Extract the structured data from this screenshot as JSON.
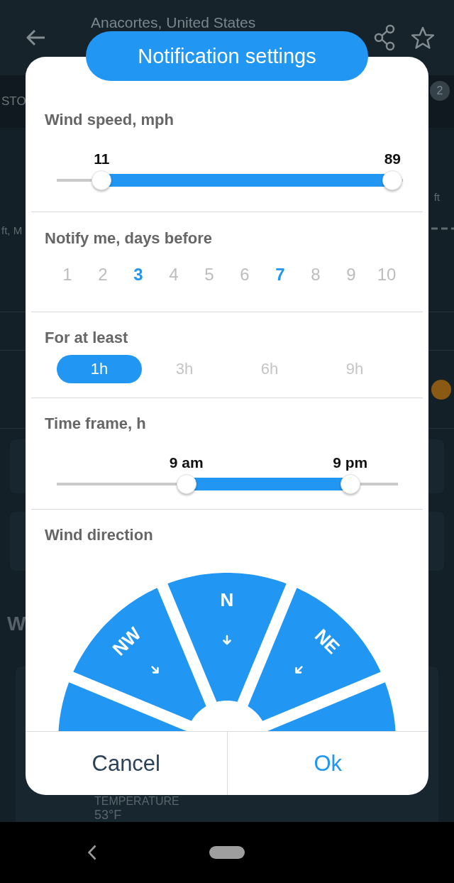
{
  "app_bar": {
    "title": "Anacortes, United States"
  },
  "tab_strip": {
    "tab_label": "STO",
    "badge": "2"
  },
  "content": {
    "right_unit": "ft",
    "left_unit": "ft, M",
    "section_letter": "W",
    "card": {
      "label": "TEMPERATURE",
      "value": "53°F"
    }
  },
  "dialog": {
    "title": "Notification settings",
    "wind_speed": {
      "label": "Wind speed, mph",
      "thumbs": [
        {
          "value": "11",
          "level": 0.13
        },
        {
          "value": "89",
          "level": 0.97
        }
      ]
    },
    "days_before": {
      "label": "Notify me, days before",
      "options": [
        {
          "label": "1",
          "selected": false
        },
        {
          "label": "2",
          "selected": false
        },
        {
          "label": "3",
          "selected": true
        },
        {
          "label": "4",
          "selected": false
        },
        {
          "label": "5",
          "selected": false
        },
        {
          "label": "6",
          "selected": false
        },
        {
          "label": "7",
          "selected": true
        },
        {
          "label": "8",
          "selected": false
        },
        {
          "label": "9",
          "selected": false
        },
        {
          "label": "10",
          "selected": false
        }
      ]
    },
    "duration": {
      "label": "For at least",
      "options": [
        {
          "label": "1h",
          "selected": true
        },
        {
          "label": "3h",
          "selected": false
        },
        {
          "label": "6h",
          "selected": false
        },
        {
          "label": "9h",
          "selected": false
        }
      ]
    },
    "time_frame": {
      "label": "Time frame, h",
      "thumbs": [
        {
          "value": "9 am",
          "level": 0.38
        },
        {
          "value": "9 pm",
          "level": 0.86
        }
      ]
    },
    "wind_direction": {
      "label": "Wind direction",
      "sectors": [
        {
          "selected": true
        },
        {
          "label": "NW",
          "selected": true
        },
        {
          "label": "N",
          "selected": true
        },
        {
          "label": "NE",
          "selected": true
        },
        {
          "selected": true
        }
      ]
    },
    "buttons": [
      {
        "label": "Cancel",
        "kind": "secondary"
      },
      {
        "label": "Ok",
        "kind": "primary"
      }
    ]
  }
}
